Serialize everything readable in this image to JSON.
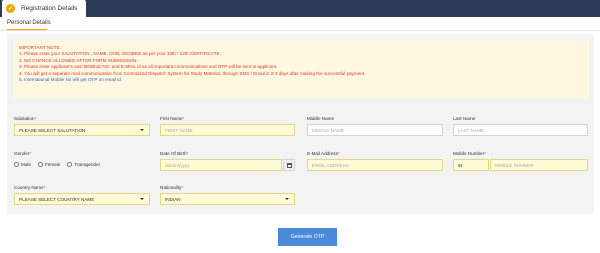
{
  "tabs": {
    "active_icon": "registration-icon",
    "active_label": "Registration Details"
  },
  "subtab": {
    "label": "Personal Details"
  },
  "notice": {
    "heading": "IMPORTANT NOTE:",
    "lines": [
      "1. Please enter your SALUTATION , NAME, DOB, GENDER as per your 10th / 12th CERTIFICATE.",
      "2. NO CHANGE ALLOWED AFTER FORM SUBMISSION.",
      "3. Please enter applicant's own MOBILE NO. and E-MAIL id as all important communications and OTP will be sent to applicant.",
      "4. You will get a separate mail communication from Centralized Dispatch System for Study Material, through SMS / Email in 2-3 days after making the successful payment.",
      "5. International Mobile No will get OTP on email id."
    ],
    "colors": {
      "warning": "#e0362c",
      "info": "#3a5fc8"
    }
  },
  "form": {
    "salutation": {
      "label": "Salutation",
      "value": "PLEASE SELECT SALUTATION"
    },
    "first_name": {
      "label": "First Name",
      "placeholder": "FIRST NAME"
    },
    "middle_name": {
      "label": "Middle Name",
      "placeholder": "MIDDLE NAME"
    },
    "last_name": {
      "label": "Last Name",
      "placeholder": "LAST NAME"
    },
    "gender": {
      "label": "Gender",
      "options": [
        "Male",
        "Female",
        "Transgender"
      ]
    },
    "dob": {
      "label": "Date Of Birth",
      "placeholder": "dd/mm/yyyy"
    },
    "email": {
      "label": "E-Mail Address",
      "placeholder": "EMAIL ADDRESS"
    },
    "mobile": {
      "label": "Mobile Number",
      "code": "91",
      "placeholder": "MOBILE NUMBER"
    },
    "country": {
      "label": "Country Name",
      "value": "PLEASE SELECT COUNTRY NAME"
    },
    "nationality": {
      "label": "Nationality",
      "value": "INDIAN"
    },
    "required_mark": "*"
  },
  "actions": {
    "generate_otp": "Generate OTP"
  },
  "colors": {
    "accent": "#f0a500",
    "header": "#2b3a55",
    "button": "#4a8ad8",
    "highlight_field": "#fffbd6"
  }
}
